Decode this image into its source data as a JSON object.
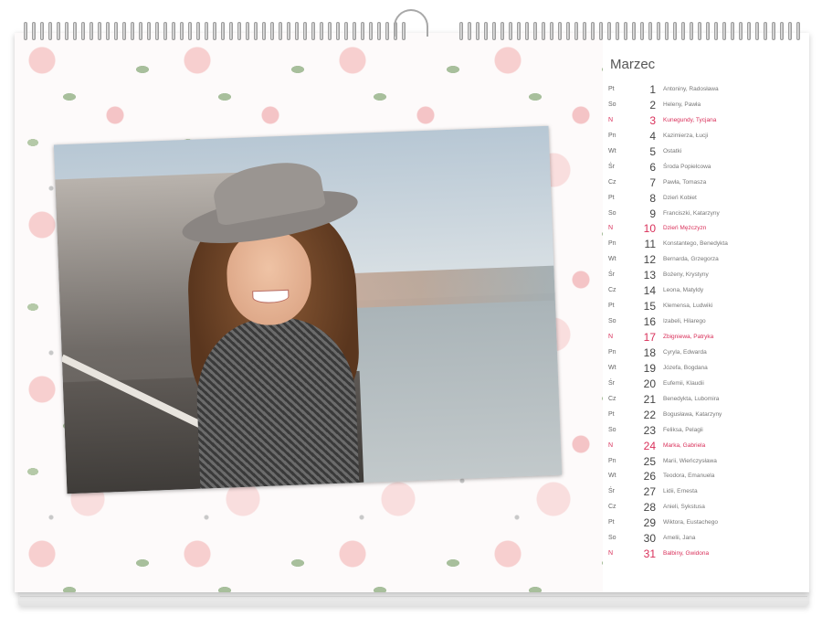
{
  "calendar": {
    "month": "Marzec",
    "days": [
      {
        "dow": "Pt",
        "num": "1",
        "names": "Antoniny, Radosława",
        "holiday": false
      },
      {
        "dow": "So",
        "num": "2",
        "names": "Heleny, Pawła",
        "holiday": false
      },
      {
        "dow": "N",
        "num": "3",
        "names": "Kunegundy, Tycjana",
        "holiday": true
      },
      {
        "dow": "Pn",
        "num": "4",
        "names": "Kazimierza, Łucji",
        "holiday": false
      },
      {
        "dow": "Wt",
        "num": "5",
        "names": "Ostatki",
        "holiday": false
      },
      {
        "dow": "Śr",
        "num": "6",
        "names": "Środa Popielcowa",
        "holiday": false
      },
      {
        "dow": "Cz",
        "num": "7",
        "names": "Pawła, Tomasza",
        "holiday": false
      },
      {
        "dow": "Pt",
        "num": "8",
        "names": "Dzień Kobiet",
        "holiday": false
      },
      {
        "dow": "So",
        "num": "9",
        "names": "Franciszki, Katarzyny",
        "holiday": false
      },
      {
        "dow": "N",
        "num": "10",
        "names": "Dzień Mężczyzn",
        "holiday": true
      },
      {
        "dow": "Pn",
        "num": "11",
        "names": "Konstantego, Benedykta",
        "holiday": false
      },
      {
        "dow": "Wt",
        "num": "12",
        "names": "Bernarda, Grzegorza",
        "holiday": false
      },
      {
        "dow": "Śr",
        "num": "13",
        "names": "Bożeny, Krystyny",
        "holiday": false
      },
      {
        "dow": "Cz",
        "num": "14",
        "names": "Leona, Matyldy",
        "holiday": false
      },
      {
        "dow": "Pt",
        "num": "15",
        "names": "Klemensa, Ludwiki",
        "holiday": false
      },
      {
        "dow": "So",
        "num": "16",
        "names": "Izabeli, Hilarego",
        "holiday": false
      },
      {
        "dow": "N",
        "num": "17",
        "names": "Zbigniewa, Patryka",
        "holiday": true
      },
      {
        "dow": "Pn",
        "num": "18",
        "names": "Cyryla, Edwarda",
        "holiday": false
      },
      {
        "dow": "Wt",
        "num": "19",
        "names": "Józefa, Bogdana",
        "holiday": false
      },
      {
        "dow": "Śr",
        "num": "20",
        "names": "Eufemii, Klaudii",
        "holiday": false
      },
      {
        "dow": "Cz",
        "num": "21",
        "names": "Benedykta, Lubomira",
        "holiday": false
      },
      {
        "dow": "Pt",
        "num": "22",
        "names": "Bogusława, Katarzyny",
        "holiday": false
      },
      {
        "dow": "So",
        "num": "23",
        "names": "Feliksa, Pelagii",
        "holiday": false
      },
      {
        "dow": "N",
        "num": "24",
        "names": "Marka, Gabriela",
        "holiday": true
      },
      {
        "dow": "Pn",
        "num": "25",
        "names": "Marii, Wieńczysława",
        "holiday": false
      },
      {
        "dow": "Wt",
        "num": "26",
        "names": "Teodora, Emanuela",
        "holiday": false
      },
      {
        "dow": "Śr",
        "num": "27",
        "names": "Lidii, Ernesta",
        "holiday": false
      },
      {
        "dow": "Cz",
        "num": "28",
        "names": "Anieli, Sykstusa",
        "holiday": false
      },
      {
        "dow": "Pt",
        "num": "29",
        "names": "Wiktora, Eustachego",
        "holiday": false
      },
      {
        "dow": "So",
        "num": "30",
        "names": "Amelii, Jana",
        "holiday": false
      },
      {
        "dow": "N",
        "num": "31",
        "names": "Balbiny, Gwidona",
        "holiday": true
      }
    ]
  },
  "colors": {
    "holiday": "#d9305a",
    "text": "#666666",
    "pattern_rose": "#f7cfcf",
    "pattern_leaf": "#a8bf9c"
  },
  "icons": [
    "spiral-binding-icon",
    "hanger-hook-icon"
  ]
}
